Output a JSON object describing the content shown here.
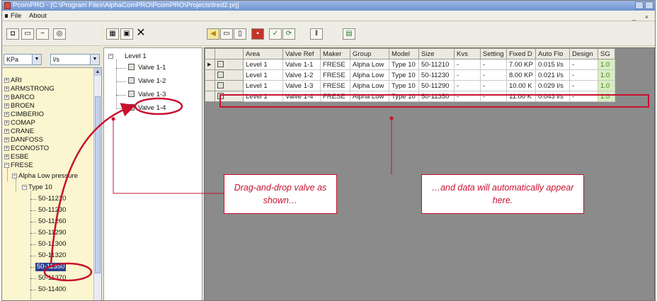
{
  "window": {
    "title": "PcomPRO - [C:\\Program Files\\AlphaComPRO\\PcomPRO\\Projects\\fred2.prj]"
  },
  "menu": {
    "items": [
      "File",
      "About"
    ],
    "mdi_controls": "_ ×"
  },
  "units": {
    "pressure": "KPa",
    "flow": "l/s"
  },
  "manufacturers": {
    "items": [
      "ARI",
      "ARMSTRONG",
      "BARCO",
      "BROEN",
      "CIMBERIO",
      "COMAP",
      "CRANE",
      "DANFOSS",
      "ECONOSTO",
      "ESBE"
    ],
    "expanded": "FRESE",
    "group": "Alpha Low pressure",
    "model": "Type 10",
    "codes": [
      "50-11210",
      "50-11230",
      "50-11260",
      "50-11290",
      "50-11300",
      "50-11320",
      "50-11350",
      "50-11370",
      "50-11400"
    ],
    "selected_code": "50-11350"
  },
  "project_tree": {
    "level": "Level 1",
    "valves": [
      "Valve 1-1",
      "Valve 1-2",
      "Valve 1-3",
      "Valve 1-4"
    ]
  },
  "grid": {
    "columns": [
      "Area",
      "Valve Ref",
      "Maker",
      "Group",
      "Model",
      "Size",
      "Kvs",
      "Setting",
      "Fixed D",
      "Auto Flo",
      "Design",
      "SG"
    ],
    "rows": [
      [
        "Level 1",
        "Valve 1-1",
        "FRESE",
        "Alpha Low",
        "Type 10",
        "50-11210",
        "-",
        "-",
        "7.00 KP",
        "0.015 l/s",
        "-",
        "1.0"
      ],
      [
        "Level 1",
        "Valve 1-2",
        "FRESE",
        "Alpha Low",
        "Type 10",
        "50-11230",
        "-",
        "-",
        "8.00 KP",
        "0.021 l/s",
        "-",
        "1.0"
      ],
      [
        "Level 1",
        "Valve 1-3",
        "FRESE",
        "Alpha Low",
        "Type 10",
        "50-11290",
        "-",
        "-",
        "10.00 K",
        "0.029 l/s",
        "-",
        "1.0"
      ],
      [
        "Level 1",
        "Valve 1-4",
        "FRESE",
        "Alpha Low",
        "Type 10",
        "50-11350",
        "-",
        "-",
        "11.00 K",
        "0.043 l/s",
        "-",
        "1.0"
      ]
    ]
  },
  "annotations": {
    "drag_text": "Drag-and-drop valve as shown…",
    "data_text": "…and data will automatically appear here.",
    "color": "#c8102e"
  }
}
